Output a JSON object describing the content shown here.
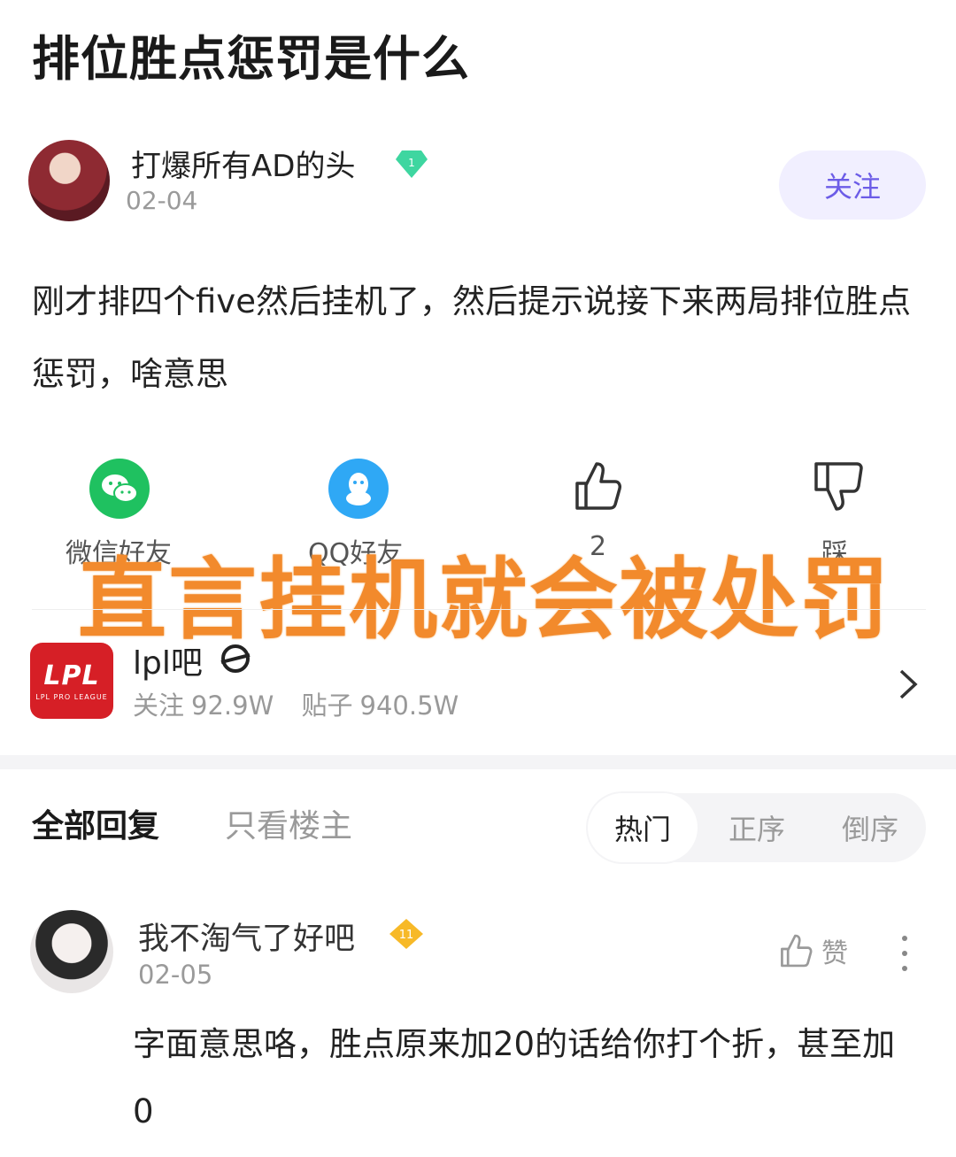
{
  "post": {
    "title": "排位胜点惩罚是什么",
    "author": {
      "name": "打爆所有AD的头",
      "level_badge": "1",
      "date": "02-04",
      "follow_label": "关注"
    },
    "body": "刚才排四个five然后挂机了，然后提示说接下来两局排位胜点惩罚，啥意思"
  },
  "actions": {
    "wechat_label": "微信好友",
    "qq_label": "QQ好友",
    "like_count": "2",
    "dislike_label": "踩",
    "colors": {
      "wechat": "#1fc160",
      "qq": "#2fa8f5"
    }
  },
  "overlay": {
    "text": "直言挂机就会被处罚",
    "color": "#f28a2c"
  },
  "forum": {
    "logo_text": "LPL",
    "logo_sub": "LPL PRO LEAGUE",
    "name": "lpl吧",
    "followers_label": "关注",
    "followers": "92.9W",
    "posts_label": "贴子",
    "posts": "940.5W"
  },
  "replies_header": {
    "all_label": "全部回复",
    "op_only_label": "只看楼主",
    "sort_options": [
      "热门",
      "正序",
      "倒序"
    ],
    "active_sort": "热门"
  },
  "replies": [
    {
      "name": "我不淘气了好吧",
      "level_badge": "11",
      "date": "02-05",
      "like_label": "赞",
      "body": "字面意思咯，胜点原来加20的话给你打个折，甚至加0"
    }
  ]
}
